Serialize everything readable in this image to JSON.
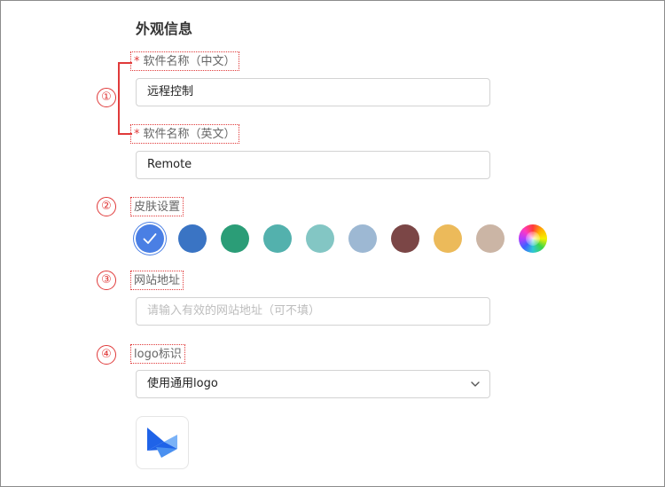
{
  "section_title": "外观信息",
  "fields": {
    "name_cn": {
      "required_mark": "*",
      "label": "软件名称（中文）",
      "value": "远程控制"
    },
    "name_en": {
      "required_mark": "*",
      "label": "软件名称（英文）",
      "value": "Remote"
    },
    "skin": {
      "label": "皮肤设置"
    },
    "website": {
      "label": "网站地址",
      "placeholder": "请输入有效的网站地址（可不填）"
    },
    "logo": {
      "label": "logo标识",
      "selected": "使用通用logo"
    }
  },
  "annotations": [
    "①",
    "②",
    "③",
    "④"
  ],
  "skin_colors": [
    "#4a7fe4",
    "#3a74c4",
    "#2b9d77",
    "#53b1ad",
    "#83c6c4",
    "#9db8d3",
    "#7b4646",
    "#ecba5a",
    "#cbb5a5",
    "rainbow"
  ],
  "selected_skin_index": 0,
  "icons": {
    "selected_check": "check-icon",
    "select_arrow": "chevron-down-icon",
    "logo": "app-logo-icon"
  }
}
